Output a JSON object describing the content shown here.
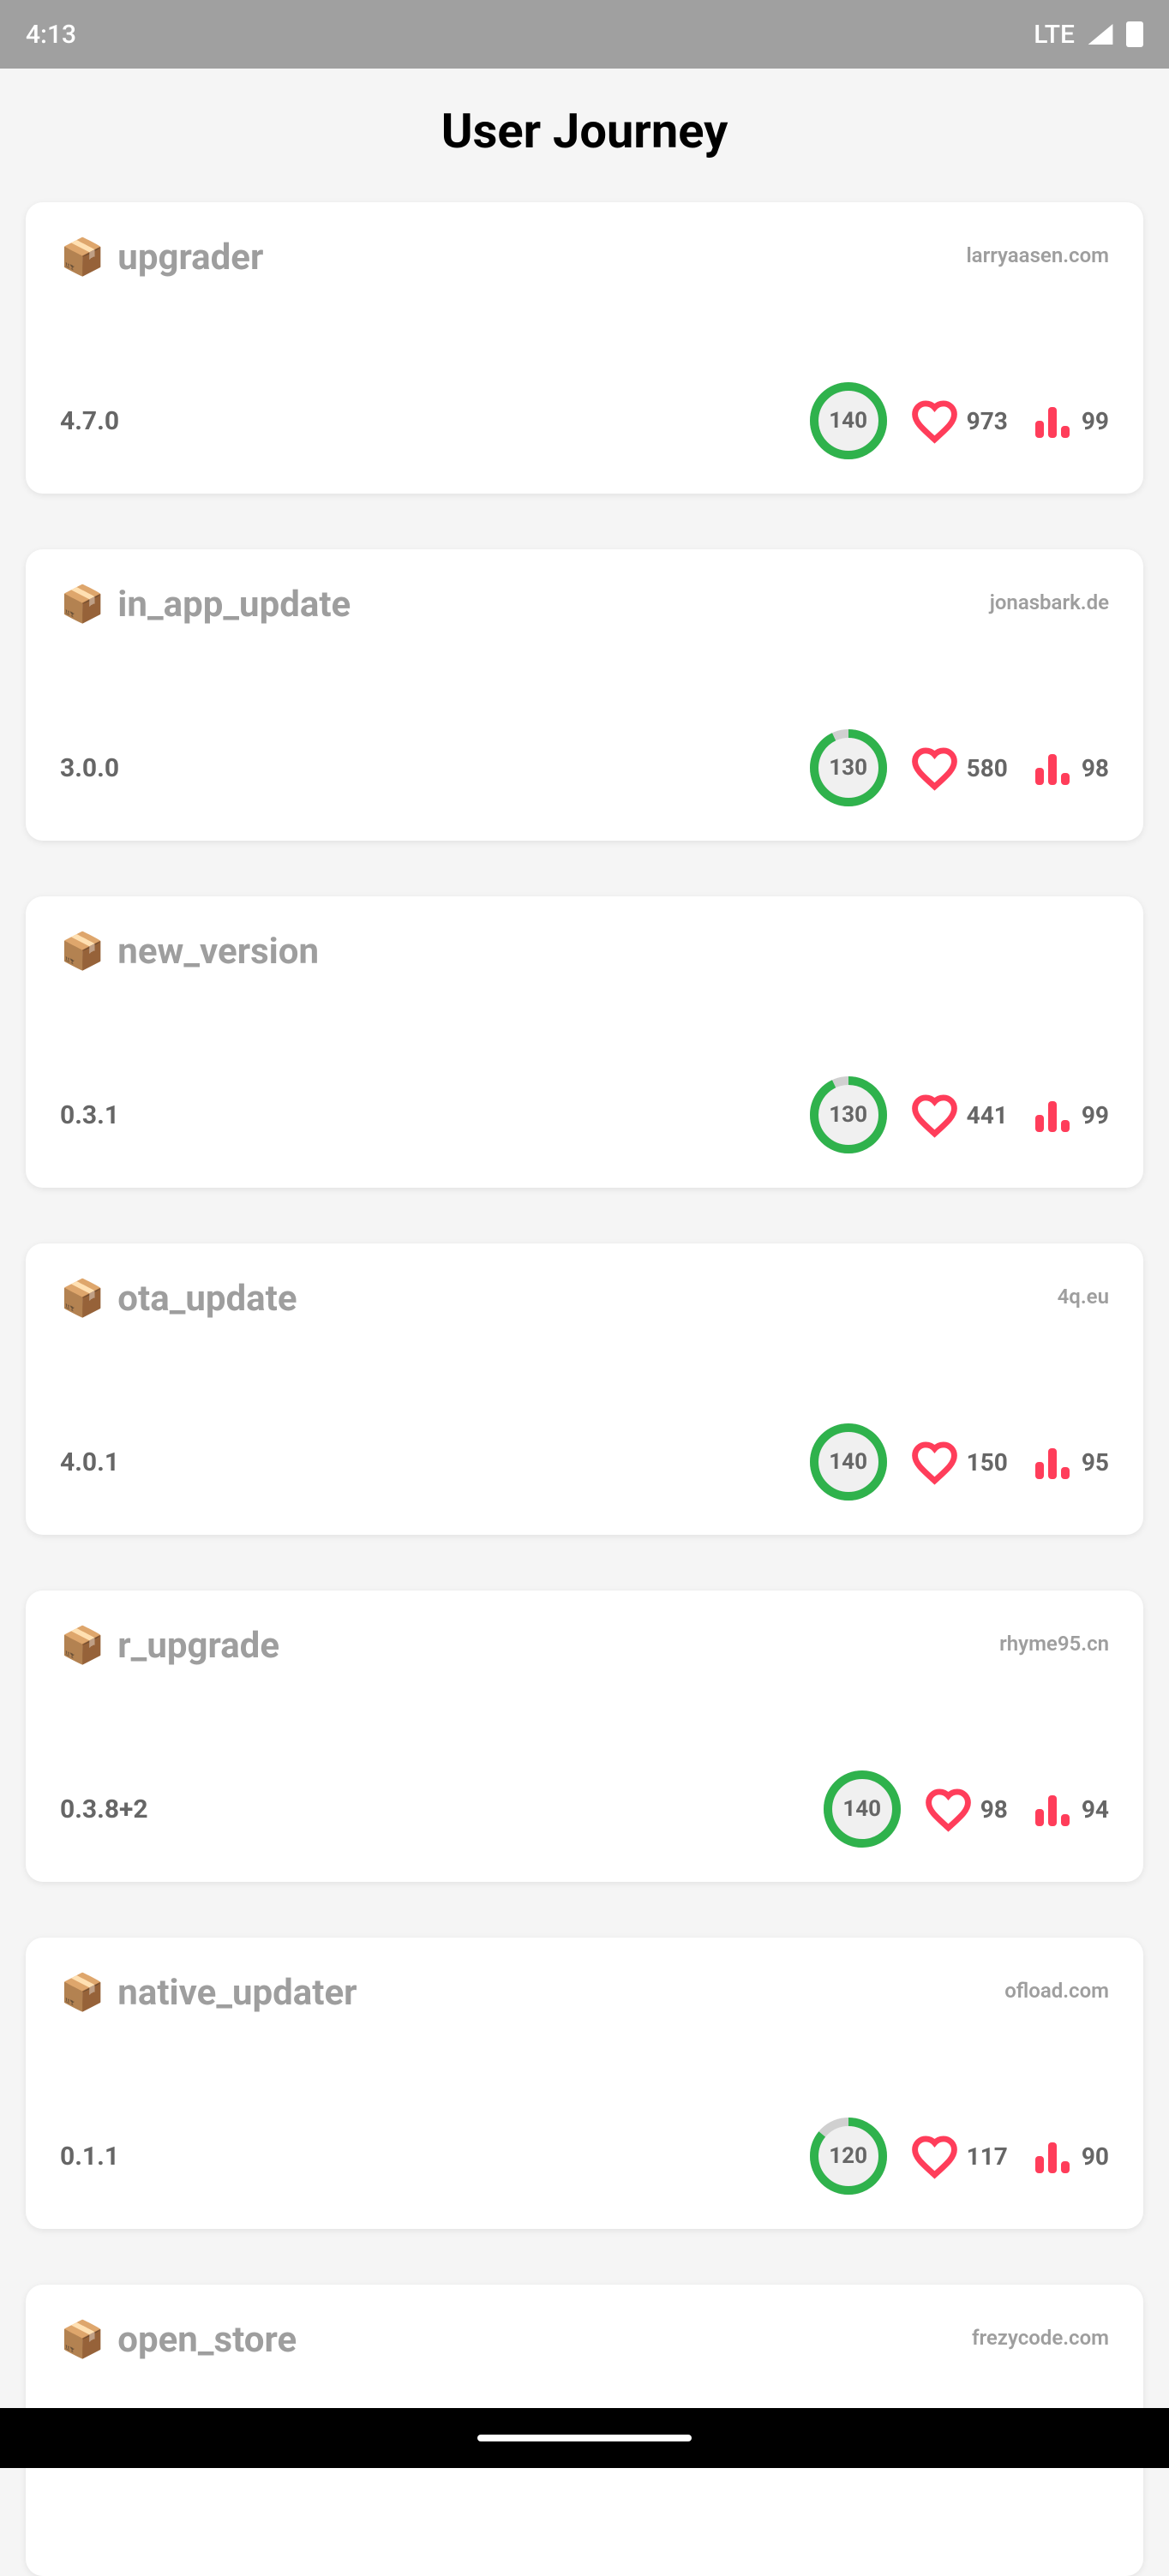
{
  "status_bar": {
    "time": "4:13",
    "network": "LTE"
  },
  "page_title": "User Journey",
  "packages": [
    {
      "name": "upgrader",
      "publisher": "larryaasen.com",
      "version": "4.7.0",
      "score": "140",
      "score_fill": 100,
      "likes": "973",
      "popularity": "99"
    },
    {
      "name": "in_app_update",
      "publisher": "jonasbark.de",
      "version": "3.0.0",
      "score": "130",
      "score_fill": 93,
      "likes": "580",
      "popularity": "98"
    },
    {
      "name": "new_version",
      "publisher": "",
      "version": "0.3.1",
      "score": "130",
      "score_fill": 93,
      "likes": "441",
      "popularity": "99"
    },
    {
      "name": "ota_update",
      "publisher": "4q.eu",
      "version": "4.0.1",
      "score": "140",
      "score_fill": 100,
      "likes": "150",
      "popularity": "95"
    },
    {
      "name": "r_upgrade",
      "publisher": "rhyme95.cn",
      "version": "0.3.8+2",
      "score": "140",
      "score_fill": 100,
      "likes": "98",
      "popularity": "94"
    },
    {
      "name": "native_updater",
      "publisher": "ofload.com",
      "version": "0.1.1",
      "score": "120",
      "score_fill": 86,
      "likes": "117",
      "popularity": "90"
    },
    {
      "name": "open_store",
      "publisher": "frezycode.com",
      "version": "",
      "score": "",
      "score_fill": 0,
      "likes": "",
      "popularity": ""
    }
  ]
}
